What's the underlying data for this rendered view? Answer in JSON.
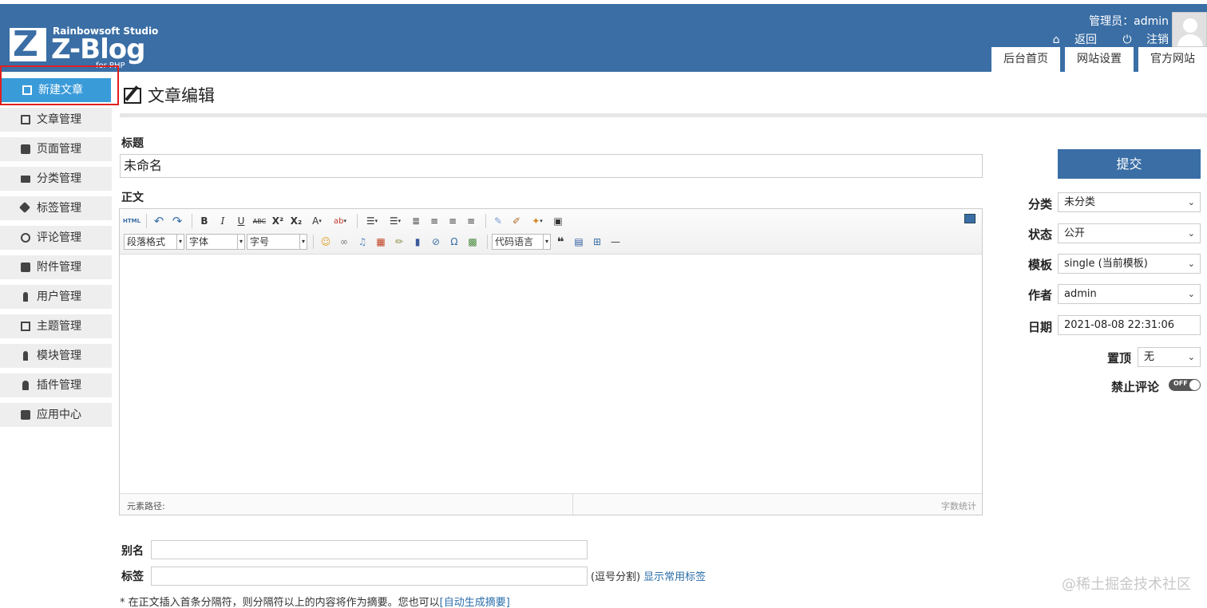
{
  "header": {
    "logo": {
      "studio": "Rainbowsoft Studio",
      "brand": "Z-Blog",
      "sub": "for PHP",
      "mark": "Z"
    },
    "admin_label": "管理员：admin",
    "back_label": "返回",
    "logout_label": "注销",
    "tabs": [
      "后台首页",
      "网站设置",
      "官方网站"
    ]
  },
  "sidebar": {
    "items": [
      {
        "label": "新建文章",
        "icon": "edit-icon"
      },
      {
        "label": "文章管理",
        "icon": "document-icon"
      },
      {
        "label": "页面管理",
        "icon": "pages-icon"
      },
      {
        "label": "分类管理",
        "icon": "folder-icon"
      },
      {
        "label": "标签管理",
        "icon": "tag-icon"
      },
      {
        "label": "评论管理",
        "icon": "comment-icon"
      },
      {
        "label": "附件管理",
        "icon": "attachment-icon"
      },
      {
        "label": "用户管理",
        "icon": "user-icon"
      },
      {
        "label": "主题管理",
        "icon": "theme-icon"
      },
      {
        "label": "模块管理",
        "icon": "module-icon"
      },
      {
        "label": "插件管理",
        "icon": "plugin-icon"
      },
      {
        "label": "应用中心",
        "icon": "app-center-icon"
      }
    ]
  },
  "main": {
    "page_title": "文章编辑",
    "title_label": "标题",
    "title_value": "未命名",
    "body_label": "正文",
    "editor": {
      "toolbar_row1": [
        "HTML",
        "↶",
        "↷",
        "B",
        "I",
        "U",
        "ABC",
        "X²",
        "X₂",
        "A",
        "ab"
      ],
      "paragraph_format": "段落格式",
      "font_family": "字体",
      "font_size": "字号",
      "code_language": "代码语言",
      "quote_mark": "❝",
      "element_path_label": "元素路径:",
      "word_count_label": "字数统计"
    },
    "alias_label": "别名",
    "tags_label": "标签",
    "tags_hint": "(逗号分割)",
    "tags_link": "显示常用标签",
    "summary_note": "* 在正文插入首条分隔符，则分隔符以上的内容将作为摘要。您也可以",
    "summary_link": "[自动生成摘要]"
  },
  "panel": {
    "submit_label": "提交",
    "category_label": "分类",
    "category_value": "未分类",
    "status_label": "状态",
    "status_value": "公开",
    "template_label": "模板",
    "template_value": "single (当前模板)",
    "author_label": "作者",
    "author_value": "admin",
    "date_label": "日期",
    "date_value": "2021-08-08 22:31:06",
    "top_label": "置顶",
    "top_value": "无",
    "disable_comment_label": "禁止评论",
    "toggle_text": "OFF",
    "toggle_on": false
  },
  "watermark": "@稀土掘金技术社区",
  "colors": {
    "header_bg": "#3a6ea5",
    "active_nav": "#3a9bd9",
    "highlight": "#e02020",
    "link": "#2a6ea8"
  }
}
